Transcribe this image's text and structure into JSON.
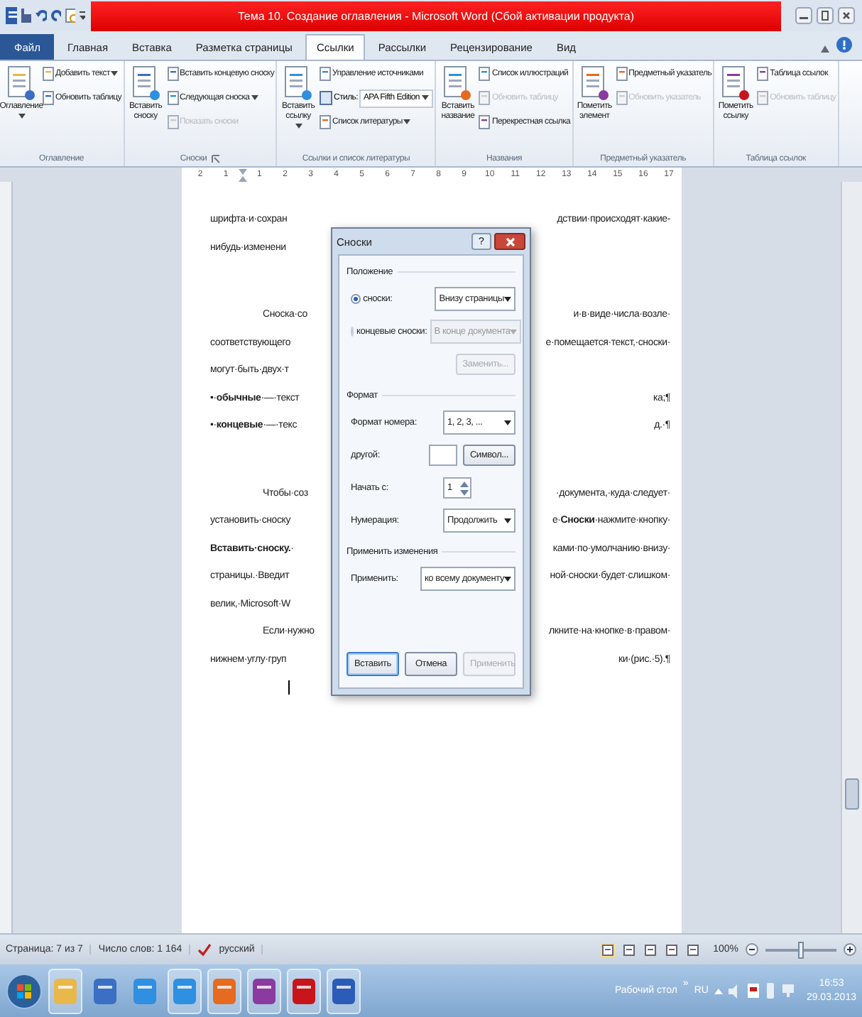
{
  "window": {
    "title": "Тема 10. Создание оглавления - Microsoft Word (Сбой активации продукта)"
  },
  "tabs": [
    {
      "label": "Файл",
      "kind": "file",
      "selected": false
    },
    {
      "label": "Главная",
      "kind": "tab",
      "selected": false
    },
    {
      "label": "Вставка",
      "kind": "tab",
      "selected": false
    },
    {
      "label": "Разметка страницы",
      "kind": "tab",
      "selected": false
    },
    {
      "label": "Ссылки",
      "kind": "tab",
      "selected": true
    },
    {
      "label": "Рассылки",
      "kind": "tab",
      "selected": false
    },
    {
      "label": "Рецензирование",
      "kind": "tab",
      "selected": false
    },
    {
      "label": "Вид",
      "kind": "tab",
      "selected": false
    }
  ],
  "ribbon": [
    {
      "label": "Оглавление",
      "launcher": false,
      "large": [
        {
          "label": "Оглавление",
          "dropdown": true
        }
      ],
      "small": [
        {
          "kind": "button",
          "label": "Добавить текст",
          "dropdown": true,
          "disabled": false
        },
        {
          "kind": "button",
          "label": "Обновить таблицу",
          "dropdown": false,
          "disabled": false
        }
      ]
    },
    {
      "label": "Сноски",
      "launcher": true,
      "large": [
        {
          "label": "Вставить сноску",
          "dropdown": false
        }
      ],
      "small": [
        {
          "kind": "button",
          "label": "Вставить концевую сноску",
          "dropdown": false,
          "disabled": false
        },
        {
          "kind": "button",
          "label": "Следующая сноска",
          "dropdown": true,
          "disabled": false
        },
        {
          "kind": "button",
          "label": "Показать сноски",
          "dropdown": false,
          "disabled": true
        }
      ]
    },
    {
      "label": "Ссылки и список литературы",
      "launcher": false,
      "large": [
        {
          "label": "Вставить ссылку",
          "dropdown": true
        }
      ],
      "small": [
        {
          "kind": "button",
          "label": "Управление источниками",
          "dropdown": false,
          "disabled": false
        },
        {
          "kind": "style",
          "label": "Стиль:",
          "value": "APA Fifth Edition"
        },
        {
          "kind": "button",
          "label": "Список литературы",
          "dropdown": true,
          "disabled": false
        }
      ]
    },
    {
      "label": "Названия",
      "launcher": false,
      "large": [
        {
          "label": "Вставить название",
          "dropdown": false
        }
      ],
      "small": [
        {
          "kind": "button",
          "label": "Список иллюстраций",
          "dropdown": false,
          "disabled": false
        },
        {
          "kind": "button",
          "label": "Обновить таблицу",
          "dropdown": false,
          "disabled": true
        },
        {
          "kind": "button",
          "label": "Перекрестная ссылка",
          "dropdown": false,
          "disabled": false
        }
      ]
    },
    {
      "label": "Предметный указатель",
      "launcher": false,
      "large": [
        {
          "label": "Пометить элемент",
          "dropdown": false
        }
      ],
      "small": [
        {
          "kind": "button",
          "label": "Предметный указатель",
          "dropdown": false,
          "disabled": false
        },
        {
          "kind": "button",
          "label": "Обновить указатель",
          "dropdown": false,
          "disabled": true
        }
      ]
    },
    {
      "label": "Таблица ссылок",
      "launcher": false,
      "large": [
        {
          "label": "Пометить ссылку",
          "dropdown": false
        }
      ],
      "small": [
        {
          "kind": "button",
          "label": "Таблица ссылок",
          "dropdown": false,
          "disabled": false
        },
        {
          "kind": "button",
          "label": "Обновить таблицу",
          "dropdown": false,
          "disabled": true
        }
      ]
    }
  ],
  "ruler": {
    "left_marks": [
      "2",
      "1"
    ],
    "marks": [
      "1",
      "2",
      "3",
      "4",
      "5",
      "6",
      "7",
      "8",
      "9",
      "10",
      "11",
      "12",
      "13",
      "14",
      "15",
      "16",
      "17"
    ]
  },
  "document": {
    "lines": [
      {
        "kind": "text",
        "indent": false,
        "left": "шрифта·и·сохран",
        "right": "дствии·происходят·какие-"
      },
      {
        "kind": "text",
        "indent": false,
        "left": "нибудь·изменени"
      },
      {
        "kind": "blank"
      },
      {
        "kind": "text",
        "indent": true,
        "left": "Сноска·со",
        "right": "и·в·виде·числа·возле·"
      },
      {
        "kind": "text",
        "indent": false,
        "left": "соответствующего",
        "right": "е·помещается·текст,·сноски·"
      },
      {
        "kind": "text",
        "indent": false,
        "left": "могут·быть·двух·т"
      },
      {
        "kind": "text",
        "indent": false,
        "left": "•·**обычные**·—·текст",
        "right": "ка;¶"
      },
      {
        "kind": "text",
        "indent": false,
        "left": "•·**концевые**·—·текс",
        "right": "д.·¶"
      },
      {
        "kind": "blank"
      },
      {
        "kind": "text",
        "indent": true,
        "left": "Чтобы·соз",
        "right": "·документа,·куда·следует·"
      },
      {
        "kind": "text",
        "indent": false,
        "left": "установить·сноску",
        "right": "е·**Сноски**·нажмите·кнопку·"
      },
      {
        "kind": "text",
        "indent": false,
        "left": "**Вставить·сноску.**·",
        "right": "ками·по·умолчанию·внизу·"
      },
      {
        "kind": "text",
        "indent": false,
        "left": "страницы.·Введит",
        "right": "ной·сноски·будет·слишком·"
      },
      {
        "kind": "text",
        "indent": false,
        "left": "велик,·Microsoft·W"
      },
      {
        "kind": "text",
        "indent": true,
        "left": "Если·нужно",
        "right": "лкните·на·кнопке·в·правом·"
      },
      {
        "kind": "text",
        "indent": false,
        "left": "нижнем·углу·груп",
        "right": "ки·(рис.·5).¶"
      }
    ]
  },
  "dialog": {
    "title": "Сноски",
    "help_label": "?",
    "sections": [
      {
        "label": "Положение",
        "rows": [
          {
            "kind": "radio",
            "label": "сноски:",
            "selected": true,
            "value": "Внизу страницы",
            "disabled": false
          },
          {
            "kind": "radio",
            "label": "концевые сноски:",
            "selected": false,
            "value": "В конце документа",
            "disabled": true
          },
          {
            "kind": "button",
            "label": "Заменить...",
            "disabled": true
          }
        ]
      },
      {
        "label": "Формат",
        "rows": [
          {
            "kind": "select",
            "label": "Формат номера:",
            "value": "1, 2, 3, ..."
          },
          {
            "kind": "symbol",
            "label": "другой:",
            "button": "Символ..."
          },
          {
            "kind": "spin",
            "label": "Начать с:",
            "value": "1"
          },
          {
            "kind": "select",
            "label": "Нумерация:",
            "value": "Продолжить"
          }
        ]
      },
      {
        "label": "Применить изменения",
        "rows": [
          {
            "kind": "select",
            "label": "Применить:",
            "value": "ко всему документу"
          }
        ]
      }
    ],
    "buttons": [
      {
        "label": "Вставить",
        "default": true,
        "disabled": false
      },
      {
        "label": "Отмена",
        "default": false,
        "disabled": false
      },
      {
        "label": "Применить",
        "default": false,
        "disabled": true
      }
    ]
  },
  "status_bar": {
    "page": "Страница: 7 из 7",
    "words": "Число слов: 1 164",
    "language": "русский",
    "zoom": "100%",
    "zoom_slider": {
      "level": 0.5
    }
  },
  "taskbar": {
    "apps": [
      {
        "open": true
      },
      {
        "open": false
      },
      {
        "open": false
      },
      {
        "open": true
      },
      {
        "open": true
      },
      {
        "open": true
      },
      {
        "open": true
      },
      {
        "open": true
      }
    ],
    "desktop_label": "Рабочий стол",
    "chevron": "»",
    "language": "RU",
    "time": "16:53",
    "date": "29.03.2013"
  }
}
